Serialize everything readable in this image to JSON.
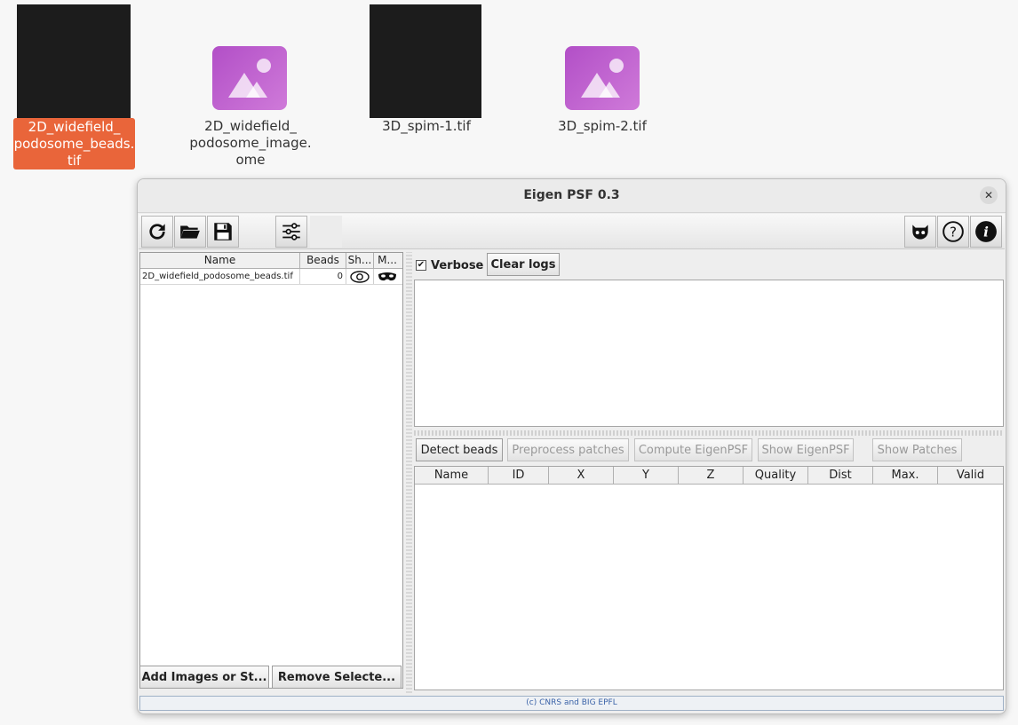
{
  "desktop": {
    "icons": [
      {
        "label_lines": [
          "2D_widefield_",
          "podosome_beads.",
          "tif"
        ],
        "selected": true
      },
      {
        "label_lines": [
          "2D_widefield_",
          "podosome_image.",
          "ome"
        ],
        "selected": false
      },
      {
        "label_lines": [
          "3D_spim-1.tif"
        ],
        "selected": false
      },
      {
        "label_lines": [
          "3D_spim-2.tif"
        ],
        "selected": false
      }
    ]
  },
  "window": {
    "title": "Eigen PSF 0.3",
    "close_symbol": "✕"
  },
  "toolbar": {
    "left_icons": [
      "refresh-icon",
      "folder-icon",
      "save-icon",
      "settings-sliders-icon"
    ],
    "right_icons": [
      "github-icon",
      "help-icon",
      "info-icon"
    ]
  },
  "images_table": {
    "columns": [
      "Name",
      "Beads",
      "Sh...",
      "M..."
    ],
    "rows": [
      {
        "name": "2D_widefield_podosome_beads.tif",
        "beads": "0",
        "show_icon": "eye-icon",
        "mask_icon": "mask-icon"
      }
    ]
  },
  "left_buttons": {
    "add": "Add Images or St...",
    "remove": "Remove Selecte..."
  },
  "log": {
    "verbose_label": "Verbose",
    "verbose_checked": true,
    "check_mark": "✔",
    "clear_label": "Clear logs"
  },
  "actions": {
    "detect": "Detect beads",
    "preprocess": "Preprocess patches",
    "compute": "Compute EigenPSF",
    "show_eigen": "Show EigenPSF",
    "show_patches": "Show Patches"
  },
  "beads_table": {
    "columns": [
      "Name",
      "ID",
      "X",
      "Y",
      "Z",
      "Quality",
      "Dist",
      "Max.",
      "Valid"
    ]
  },
  "footer": "(c) CNRS and BIG EPFL",
  "colors": {
    "selection": "#e9653a",
    "image_icon": "#c266d0"
  }
}
